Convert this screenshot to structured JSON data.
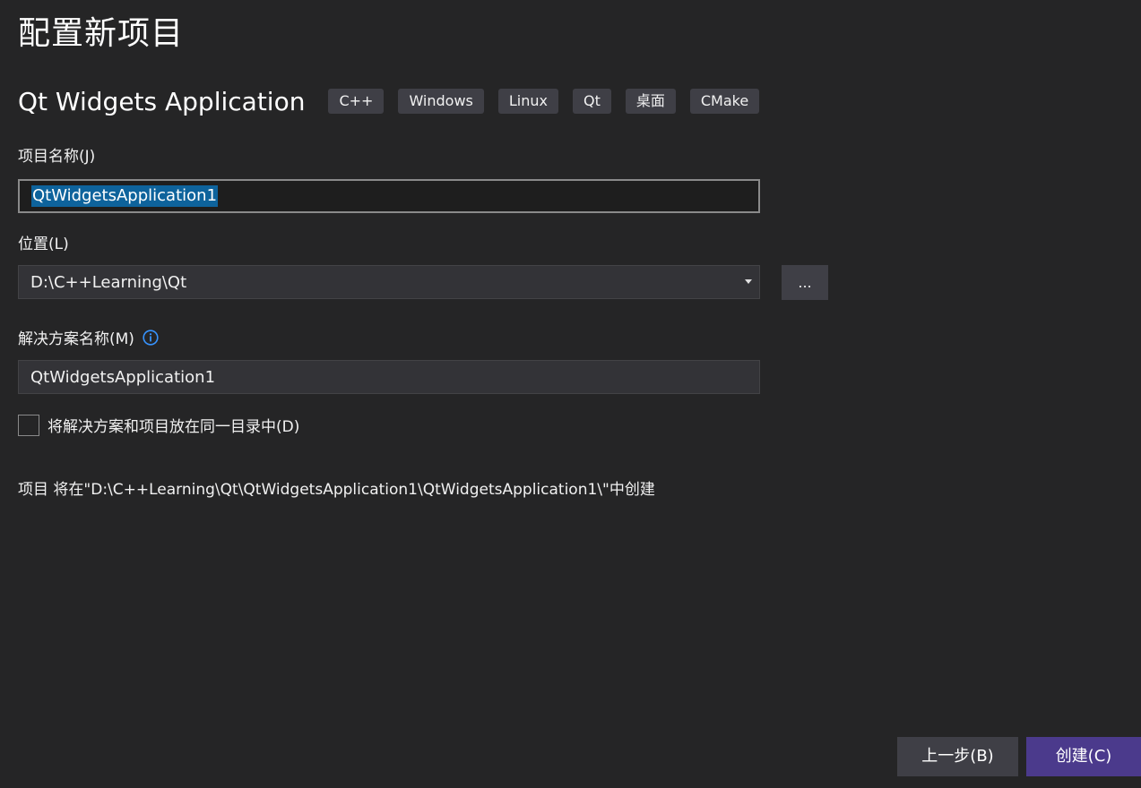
{
  "page": {
    "title": "配置新项目"
  },
  "template": {
    "name": "Qt Widgets Application",
    "tags": [
      "C++",
      "Windows",
      "Linux",
      "Qt",
      "桌面",
      "CMake"
    ]
  },
  "project_name": {
    "label": "项目名称(J)",
    "value": "QtWidgetsApplication1"
  },
  "location": {
    "label": "位置(L)",
    "value": "D:\\C++Learning\\Qt",
    "browse_label": "..."
  },
  "solution_name": {
    "label": "解决方案名称(M)",
    "value": "QtWidgetsApplication1",
    "info_icon": "info-icon"
  },
  "same_directory": {
    "label": "将解决方案和项目放在同一目录中(D)",
    "checked": false
  },
  "path_info": "项目 将在\"D:\\C++Learning\\Qt\\QtWidgetsApplication1\\QtWidgetsApplication1\\\"中创建",
  "footer": {
    "back_label": "上一步(B)",
    "create_label": "创建(C)"
  },
  "colors": {
    "background": "#252526",
    "accent": "#4b3a8c",
    "selection": "#0e639c",
    "info": "#3794ff"
  }
}
